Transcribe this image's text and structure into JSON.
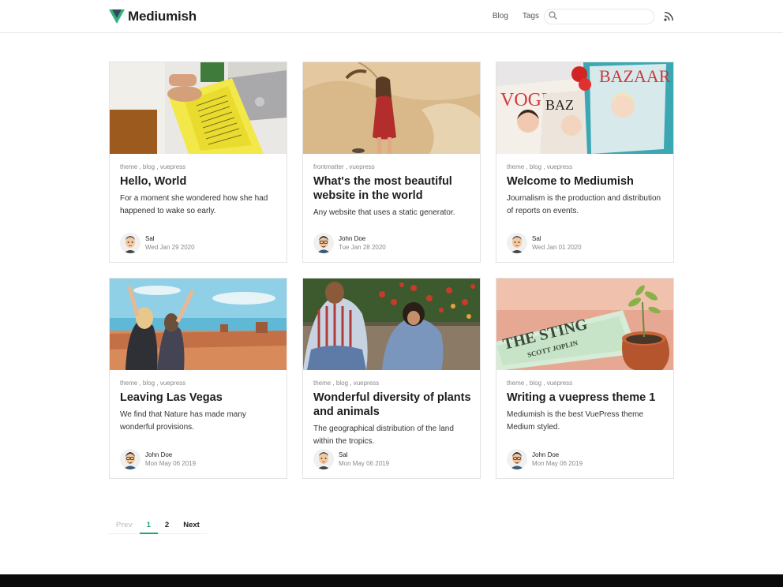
{
  "header": {
    "brand": "Mediumish",
    "nav": [
      {
        "label": "Blog"
      },
      {
        "label": "Tags"
      }
    ],
    "search": {
      "placeholder": "",
      "value": ""
    }
  },
  "posts": [
    {
      "tags": "theme , blog , vuepress",
      "title": "Hello, World",
      "excerpt": "For a moment she wondered how she had happened to wake so early.",
      "author": "Sal",
      "date": "Wed Jan 29 2020",
      "image": "newspaper-photo"
    },
    {
      "tags": "frontmatter , vuepress",
      "title": "What's the most beautiful website in the world",
      "excerpt": "Any website that uses a static generator.",
      "author": "John Doe",
      "date": "Tue Jan 28 2020",
      "image": "girl-on-sand-photo"
    },
    {
      "tags": "theme , blog , vuepress",
      "title": "Welcome to Mediumish",
      "excerpt": "Journalism is the production and distribution of reports on events.",
      "author": "Sal",
      "date": "Wed Jan 01 2020",
      "image": "magazines-photo"
    },
    {
      "tags": "theme , blog , vuepress",
      "title": "Leaving Las Vegas",
      "excerpt": "We find that Nature has made many wonderful provisions.",
      "author": "John Doe",
      "date": "Mon May 06 2019",
      "image": "desert-friends-photo"
    },
    {
      "tags": "theme , blog , vuepress",
      "title": "Wonderful diversity of plants and animals",
      "excerpt": "The geographical distribution of the land within the tropics.",
      "author": "Sal",
      "date": "Mon May 06 2019",
      "image": "friends-flowers-photo"
    },
    {
      "tags": "theme , blog , vuepress",
      "title": "Writing a vuepress theme 1",
      "excerpt": "Mediumish is the best VuePress theme Medium styled.",
      "author": "John Doe",
      "date": "Mon May 06 2019",
      "image": "the-sting-photo"
    }
  ],
  "pagination": {
    "prev": "Prev",
    "pages": [
      "1",
      "2"
    ],
    "current": "1",
    "next": "Next"
  },
  "colors": {
    "accent": "#19a57e",
    "brand_dark": "#34495e"
  }
}
